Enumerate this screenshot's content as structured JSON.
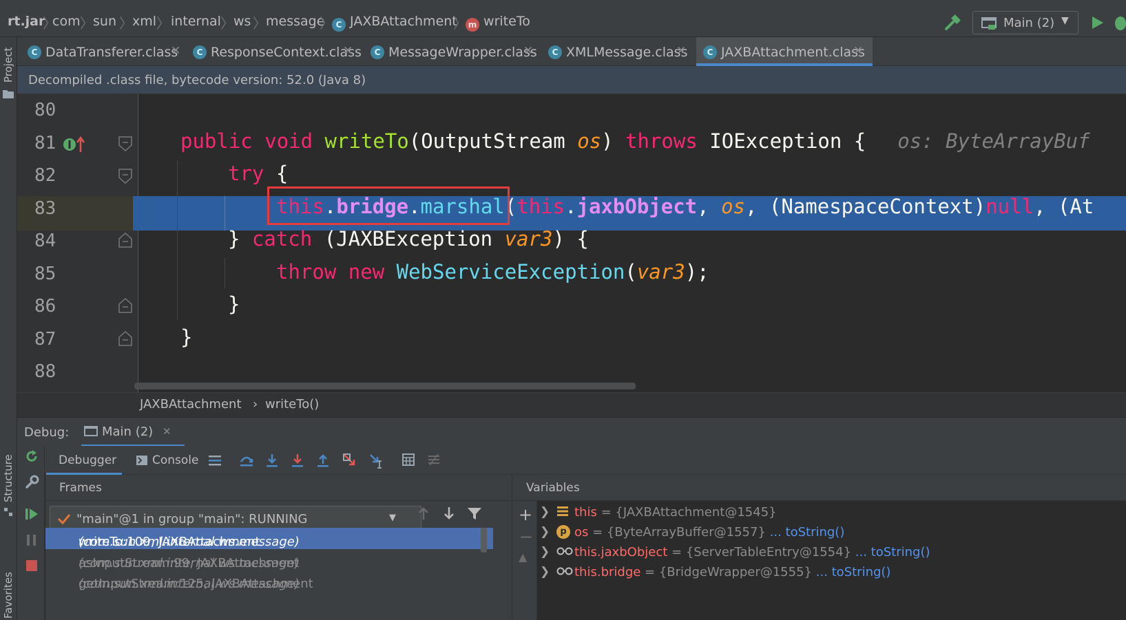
{
  "breadcrumb": {
    "items": [
      "rt.jar",
      "com",
      "sun",
      "xml",
      "internal",
      "ws",
      "message",
      "JAXBAttachment",
      "writeTo"
    ]
  },
  "run_config": {
    "label": "Main (2)"
  },
  "side_tools": {
    "project": "Project",
    "structure": "Structure",
    "favorites": "Favorites"
  },
  "tabs": [
    {
      "label": "DataTransferer.class",
      "active": false
    },
    {
      "label": "ResponseContext.class",
      "active": false
    },
    {
      "label": "MessageWrapper.class",
      "active": false
    },
    {
      "label": "XMLMessage.class",
      "active": false
    },
    {
      "label": "JAXBAttachment.class",
      "active": true
    }
  ],
  "banner": {
    "text": "Decompiled .class file, bytecode version: 52.0 (Java 8)"
  },
  "editor": {
    "line_numbers": [
      "80",
      "81",
      "82",
      "83",
      "84",
      "85",
      "86",
      "87",
      "88"
    ],
    "current_line": "83",
    "lines": {
      "l81": [
        "public",
        " ",
        "void",
        " ",
        "writeTo",
        "(OutputStream ",
        "os",
        ") ",
        "throws",
        " IOException {",
        "os: ByteArrayBuf"
      ],
      "l82": [
        "try",
        " {"
      ],
      "l83": [
        "this",
        ".",
        "bridge",
        ".",
        "marshal",
        "(",
        "this",
        ".",
        "jaxbObject",
        ", ",
        "os",
        ", (NamespaceContext)",
        "null",
        ", (At"
      ],
      "l84": [
        "} ",
        "catch",
        " (JAXBException ",
        "var3",
        ") {"
      ],
      "l85": [
        "throw",
        " ",
        "new",
        " ",
        "WebServiceException",
        "(",
        "var3",
        ");"
      ],
      "l86": [
        "}"
      ],
      "l87": [
        "}"
      ]
    }
  },
  "editor_breadcrumb": {
    "class": "JAXBAttachment",
    "sep": "›",
    "method": "writeTo()"
  },
  "debug": {
    "label": "Debug:",
    "session": "Main (2)",
    "tab_debugger": "Debugger",
    "tab_console": "Console",
    "frames_title": "Frames",
    "variables_title": "Variables",
    "thread": "\"main\"@1 in group \"main\": RUNNING",
    "frames": [
      {
        "method": "writeTo:109, JAXBAttachment",
        "pkg": "(com.sun.xml.internal.ws.message)"
      },
      {
        "method": "asInputStream:99, JAXBAttachment",
        "pkg": "(com.sun.xml.internal.ws.message)"
      },
      {
        "method": "getInputStream:125, JAXBAttachment",
        "pkg": "(com.sun.xml.internal.ws.message)"
      }
    ],
    "variables": [
      {
        "name": "this",
        "eq": " = ",
        "value": "{JAXBAttachment@1545}",
        "link": "",
        "icon": "field-icon"
      },
      {
        "name": "os",
        "eq": " = ",
        "value": "{ByteArrayBuffer@1557}",
        "link": "... toString()",
        "icon": "parameter-icon"
      },
      {
        "name": "this.jaxbObject",
        "eq": " = ",
        "value": "{ServerTableEntry@1554}",
        "link": "... toString()",
        "icon": "watch-icon"
      },
      {
        "name": "this.bridge",
        "eq": " = ",
        "value": "{BridgeWrapper@1555}",
        "link": "... toString()",
        "icon": "watch-icon"
      }
    ]
  },
  "colors": {
    "selection": "#2d5e9e",
    "frame_selected": "#4b6eaf",
    "highlight_box": "#e53b3b",
    "tab_underline": "#4a88c7"
  }
}
